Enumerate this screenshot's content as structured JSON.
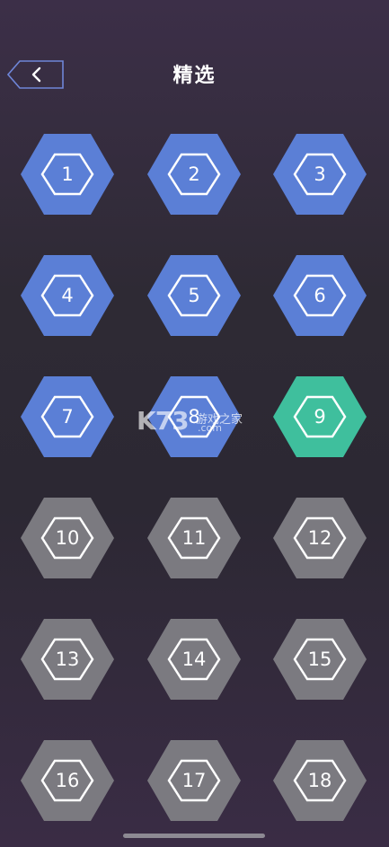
{
  "header": {
    "title": "精选",
    "back_icon": "chevron-left-icon"
  },
  "colors": {
    "unlocked": "#5b7fd6",
    "current": "#3fbf9d",
    "locked": "#7b7a80",
    "outline": "#ffffff"
  },
  "levels": [
    {
      "label": "1",
      "state": "unlocked"
    },
    {
      "label": "2",
      "state": "unlocked"
    },
    {
      "label": "3",
      "state": "unlocked"
    },
    {
      "label": "4",
      "state": "unlocked"
    },
    {
      "label": "5",
      "state": "unlocked"
    },
    {
      "label": "6",
      "state": "unlocked"
    },
    {
      "label": "7",
      "state": "unlocked"
    },
    {
      "label": "8",
      "state": "unlocked"
    },
    {
      "label": "9",
      "state": "current"
    },
    {
      "label": "10",
      "state": "locked"
    },
    {
      "label": "11",
      "state": "locked"
    },
    {
      "label": "12",
      "state": "locked"
    },
    {
      "label": "13",
      "state": "locked"
    },
    {
      "label": "14",
      "state": "locked"
    },
    {
      "label": "15",
      "state": "locked"
    },
    {
      "label": "16",
      "state": "locked"
    },
    {
      "label": "17",
      "state": "locked"
    },
    {
      "label": "18",
      "state": "locked"
    }
  ],
  "watermark": {
    "logo": "K73",
    "name": "游戏之家",
    "domain": ".com"
  }
}
